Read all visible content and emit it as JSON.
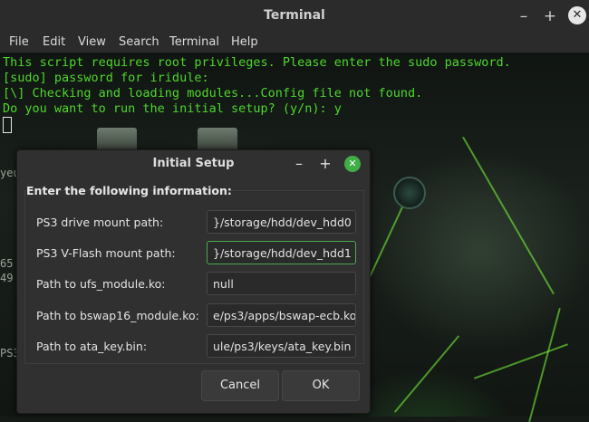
{
  "window": {
    "title": "Terminal"
  },
  "menu": {
    "items": [
      "File",
      "Edit",
      "View",
      "Search",
      "Terminal",
      "Help"
    ]
  },
  "terminal": {
    "lines": [
      "This script requires root privileges. Please enter the sudo password.",
      "[sudo] password for iridule:",
      "[\\] Checking and loading modules...Config file not found.",
      "Do you want to run the initial setup? (y/n): y"
    ],
    "side_fragments": [
      "yeu",
      "65",
      "49",
      "PS3"
    ]
  },
  "colors": {
    "terminal_text": "#4fd62c",
    "accent": "#3fae45"
  },
  "dialog": {
    "title": "Initial Setup",
    "header": "Enter the following information:",
    "fields": [
      {
        "label": "PS3 drive mount path:",
        "value": "}/storage/hdd/dev_hdd0"
      },
      {
        "label": "PS3 V-Flash mount path:",
        "value": "}/storage/hdd/dev_hdd1"
      },
      {
        "label": "Path to ufs_module.ko:",
        "value": "null"
      },
      {
        "label": "Path to bswap16_module.ko:",
        "value": "e/ps3/apps/bswap-ecb.ko"
      },
      {
        "label": "Path to ata_key.bin:",
        "value": "ule/ps3/keys/ata_key.bin"
      }
    ],
    "cancel_label": "Cancel",
    "ok_label": "OK"
  }
}
